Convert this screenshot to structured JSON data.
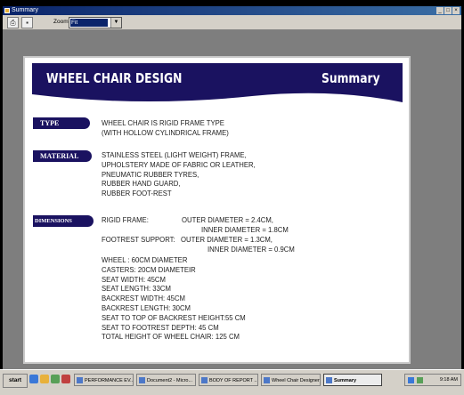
{
  "window": {
    "title": "Summary"
  },
  "toolbar": {
    "zoom_label": "Zoom",
    "zoom_value": "Fit",
    "icons": [
      "printer-icon",
      "save-icon"
    ]
  },
  "slide": {
    "title": "WHEEL CHAIR DESIGN",
    "subtitle": "Summary",
    "banner_color": "#1a1260",
    "sections": {
      "type": {
        "tag": "TYPE",
        "lines": [
          "WHEEL CHAIR IS RIGID FRAME TYPE",
          "(WITH HOLLOW CYLINDRICAL FRAME)"
        ]
      },
      "material": {
        "tag": "MATERIAL",
        "lines": [
          "STAINLESS STEEL (LIGHT WEIGHT) FRAME,",
          "UPHOLSTERY MADE OF FABRIC OR LEATHER,",
          "PNEUMATIC RUBBER TYRES,",
          "RUBBER HAND GUARD,",
          "RUBBER FOOT-REST"
        ]
      },
      "dimensions": {
        "tag": "DIMENSIONS",
        "rigid_frame_label": "RIGID FRAME:",
        "rigid_outer": "OUTER DIAMETER = 2.4CM,",
        "rigid_inner": "INNER DIAMETER = 1.8CM",
        "footrest_label": "FOOTREST SUPPORT:",
        "footrest_outer": "OUTER DIAMETER = 1.3CM,",
        "footrest_inner": "INNER DIAMETER = 0.9CM",
        "lines": [
          "WHEEL : 60CM DIAMETER",
          "CASTERS: 20CM DIAMETEIR",
          "SEAT WIDTH: 45CM",
          "SEAT LENGTH: 33CM",
          "BACKREST WIDTH: 45CM",
          "BACKREST LENGTH: 30CM",
          "SEAT TO TOP OF BACKREST HEIGHT:55 CM",
          "SEAT TO FOOTREST  DEPTH: 45 CM",
          "TOTAL HEIGHT OF WHEEL CHAIR: 125 CM"
        ]
      }
    }
  },
  "taskbar": {
    "start_label": "start",
    "tasks": [
      "PERFORMANCE EV...",
      "Document2 - Micro...",
      "BODY OF REPORT ...",
      "Wheel Chair Designer",
      "Summary"
    ],
    "clock": "9:18 AM"
  }
}
